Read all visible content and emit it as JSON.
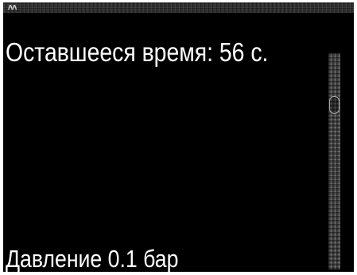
{
  "header": {
    "status_mark": "ᴧᴧ"
  },
  "main": {
    "remaining_time": "Оставшееся время: 56 с.",
    "pressure": "Давление 0.1 бар"
  },
  "colors": {
    "background": "#000000",
    "text": "#ffffff"
  }
}
